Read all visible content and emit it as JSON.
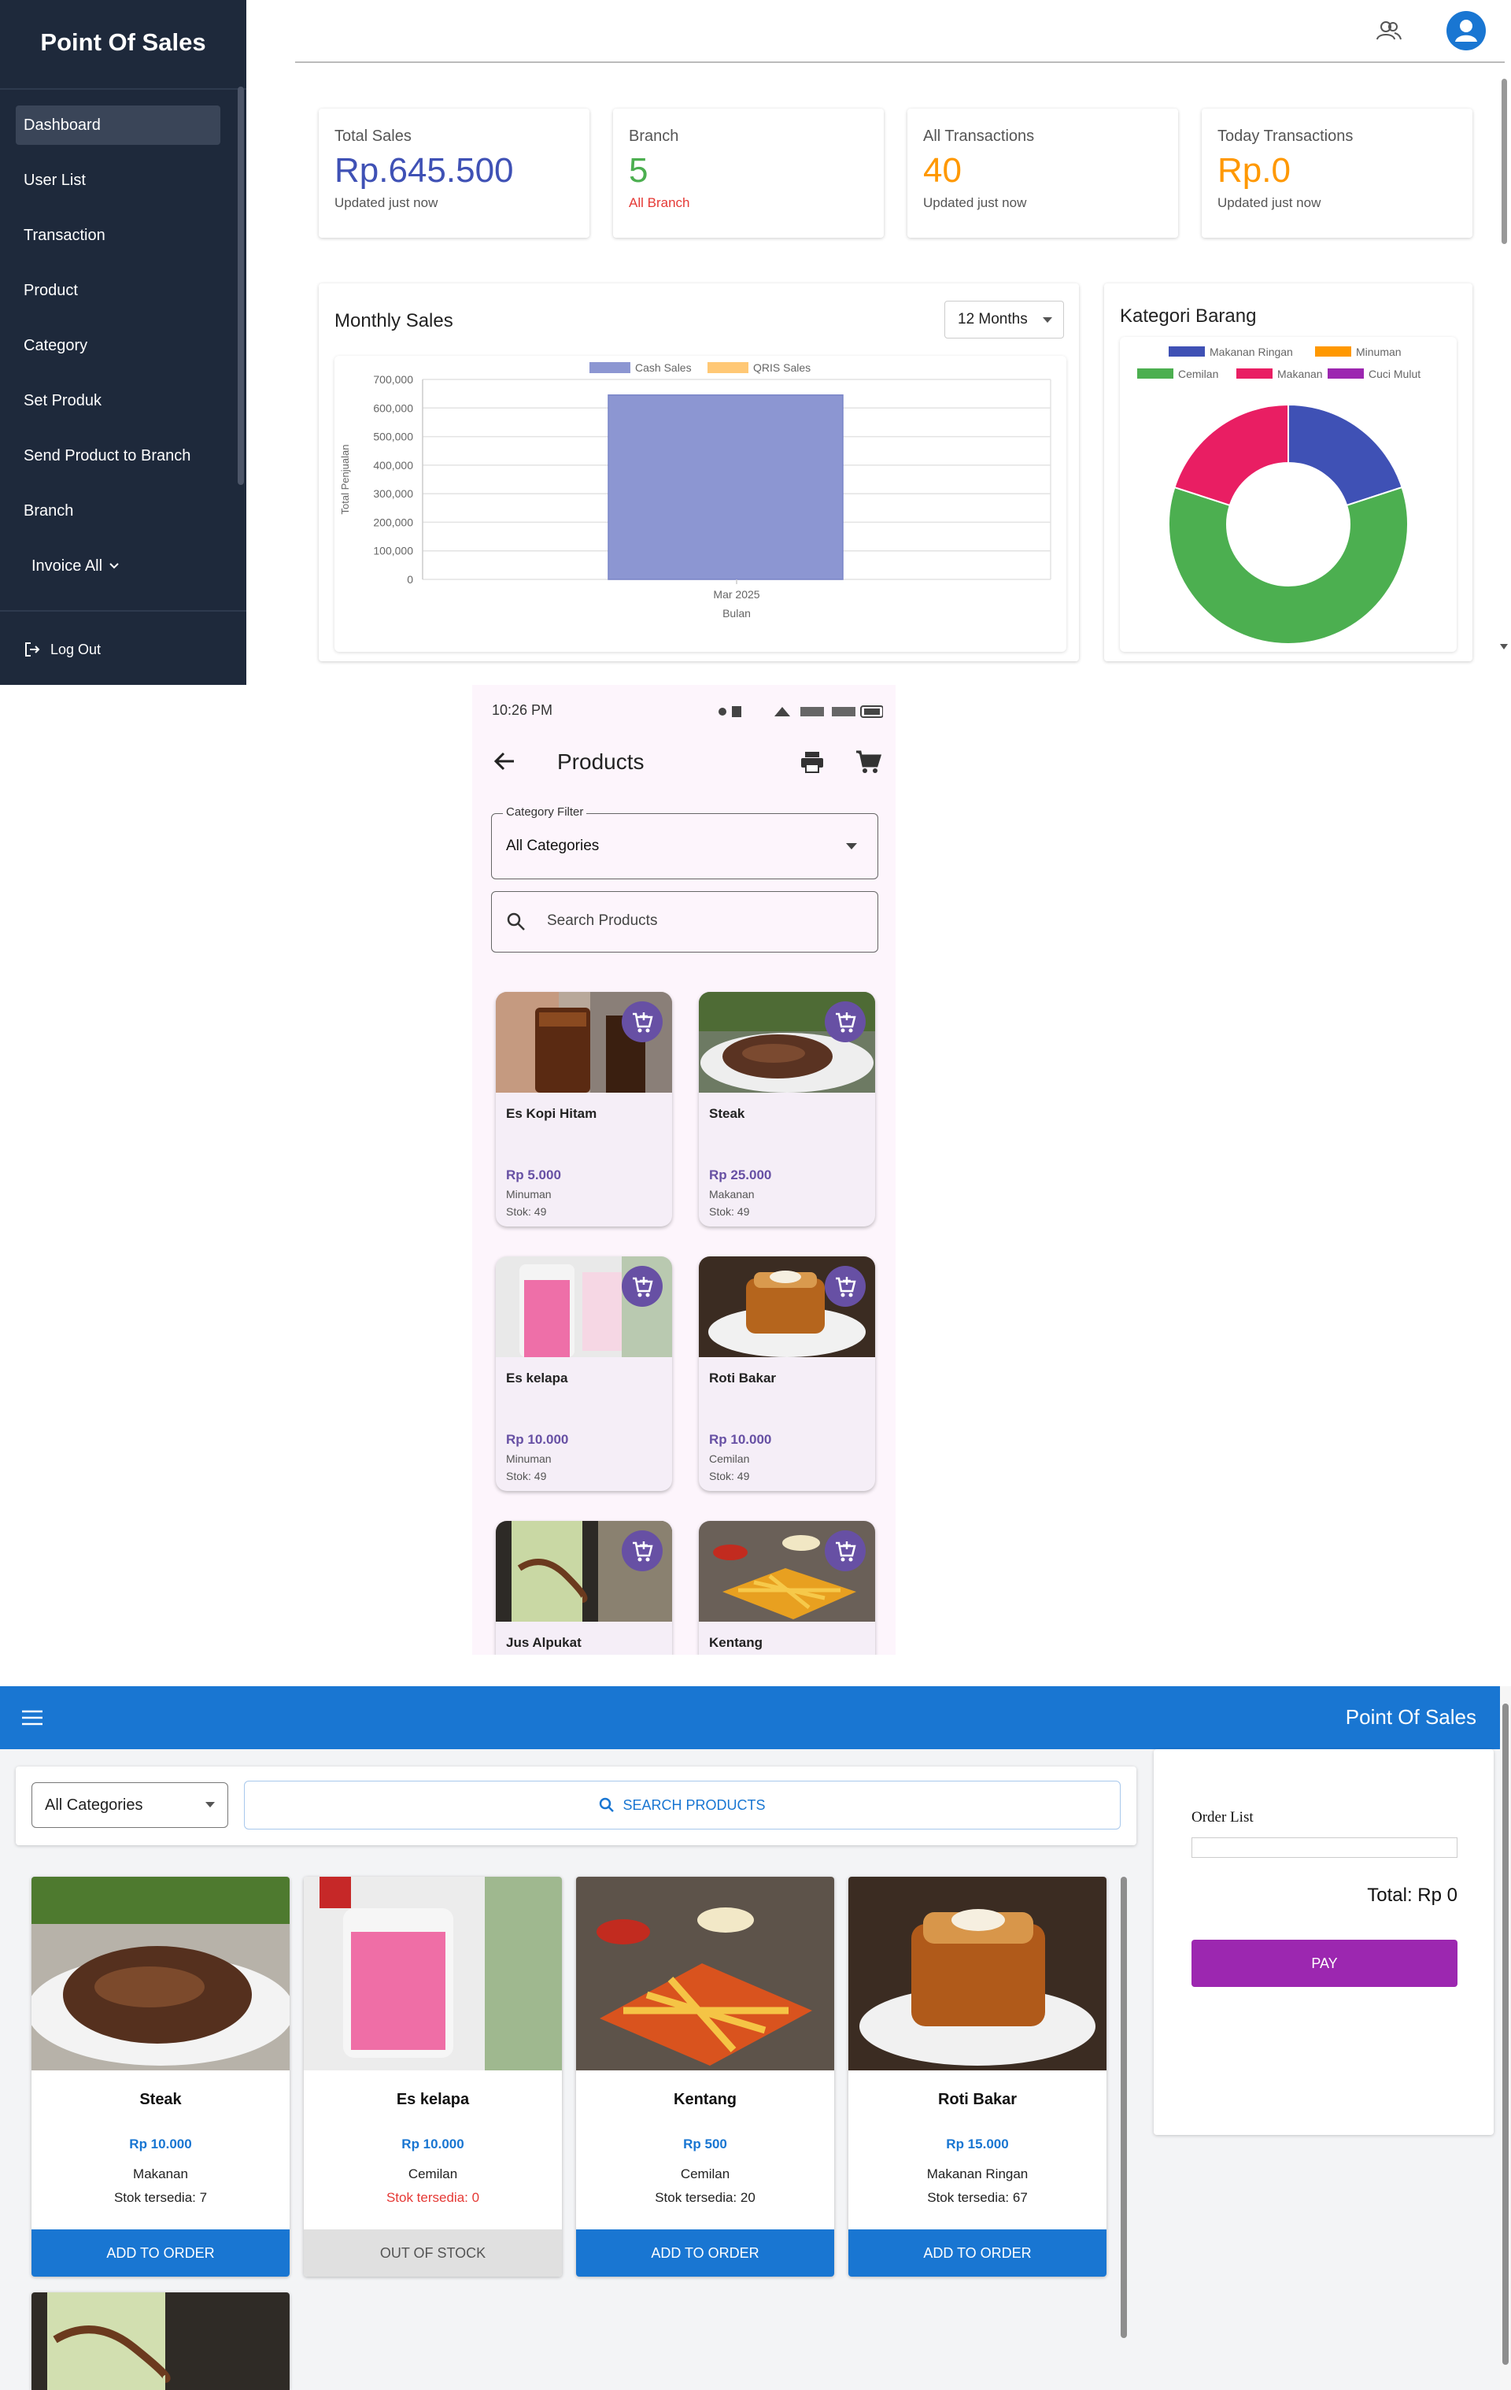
{
  "dashboard": {
    "sidebar": {
      "brand": "Point Of Sales",
      "items": [
        {
          "label": "Dashboard"
        },
        {
          "label": "User List"
        },
        {
          "label": "Transaction"
        },
        {
          "label": "Product"
        },
        {
          "label": "Category"
        },
        {
          "label": "Set Produk"
        },
        {
          "label": "Send Product to Branch"
        },
        {
          "label": "Branch"
        },
        {
          "label": "Invoice All"
        }
      ],
      "logout": "Log Out"
    },
    "stats": [
      {
        "label": "Total Sales",
        "value": "Rp.645.500",
        "sub": "Updated just now",
        "color": "#3f51b5"
      },
      {
        "label": "Branch",
        "value": "5",
        "sub": "All Branch",
        "color": "#4caf50",
        "sub_color": "#e53935"
      },
      {
        "label": "All Transactions",
        "value": "40",
        "sub": "Updated just now",
        "color": "#ff9800"
      },
      {
        "label": "Today Transactions",
        "value": "Rp.0",
        "sub": "Updated just now",
        "color": "#ff9800"
      }
    ],
    "monthly": {
      "title": "Monthly Sales",
      "range_select": "12 Months"
    },
    "kategori": {
      "title": "Kategori Barang"
    }
  },
  "chart_data": [
    {
      "type": "bar",
      "title": "Monthly Sales",
      "categories": [
        "Mar 2025"
      ],
      "series": [
        {
          "name": "Cash Sales",
          "values": [
            645500
          ],
          "color": "#8c96d2"
        },
        {
          "name": "QRIS Sales",
          "values": [
            0
          ],
          "color": "#ffc875"
        }
      ],
      "xlabel": "Bulan",
      "ylabel": "Total Penjualan",
      "ylim": [
        0,
        700000
      ],
      "yticks": [
        "700,000",
        "600,000",
        "500,000",
        "400,000",
        "300,000",
        "200,000",
        "100,000",
        "0"
      ],
      "grid": true,
      "legend": "top"
    },
    {
      "type": "pie",
      "title": "Kategori Barang",
      "donut": true,
      "slices": [
        {
          "name": "Makanan Ringan",
          "value": 20,
          "color": "#3f51b5"
        },
        {
          "name": "Minuman",
          "value": 0,
          "color": "#ff9800"
        },
        {
          "name": "Cemilan",
          "value": 60,
          "color": "#4caf50"
        },
        {
          "name": "Makanan",
          "value": 20,
          "color": "#e91e63"
        },
        {
          "name": "Cuci Mulut",
          "value": 0,
          "color": "#9c27b0"
        }
      ],
      "legend": "top"
    }
  ],
  "mobile": {
    "status_time": "10:26 PM",
    "title": "Products",
    "category_label": "Category Filter",
    "category_value": "All Categories",
    "search_placeholder": "Search Products",
    "products": [
      {
        "name": "Es Kopi Hitam",
        "price": "Rp 5.000",
        "category": "Minuman",
        "stock": "Stok: 49"
      },
      {
        "name": "Steak",
        "price": "Rp 25.000",
        "category": "Makanan",
        "stock": "Stok: 49"
      },
      {
        "name": "Es kelapa",
        "price": "Rp 10.000",
        "category": "Minuman",
        "stock": "Stok: 49"
      },
      {
        "name": "Roti Bakar",
        "price": "Rp 10.000",
        "category": "Cemilan",
        "stock": "Stok: 49"
      },
      {
        "name": "Jus Alpukat"
      },
      {
        "name": "Kentang"
      }
    ]
  },
  "pos": {
    "title": "Point Of Sales",
    "category_select": "All Categories",
    "search_button": "SEARCH PRODUCTS",
    "order_list": "Order List",
    "total": "Total: Rp 0",
    "pay": "PAY",
    "products": [
      {
        "name": "Steak",
        "price": "Rp 10.000",
        "category": "Makanan",
        "stock": "Stok tersedia: 7",
        "button": "ADD TO ORDER"
      },
      {
        "name": "Es kelapa",
        "price": "Rp 10.000",
        "category": "Cemilan",
        "stock": "Stok tersedia: 0",
        "button": "OUT OF STOCK"
      },
      {
        "name": "Kentang",
        "price": "Rp 500",
        "category": "Cemilan",
        "stock": "Stok tersedia: 20",
        "button": "ADD TO ORDER"
      },
      {
        "name": "Roti Bakar",
        "price": "Rp 15.000",
        "category": "Makanan Ringan",
        "stock": "Stok tersedia: 67",
        "button": "ADD TO ORDER"
      }
    ]
  }
}
